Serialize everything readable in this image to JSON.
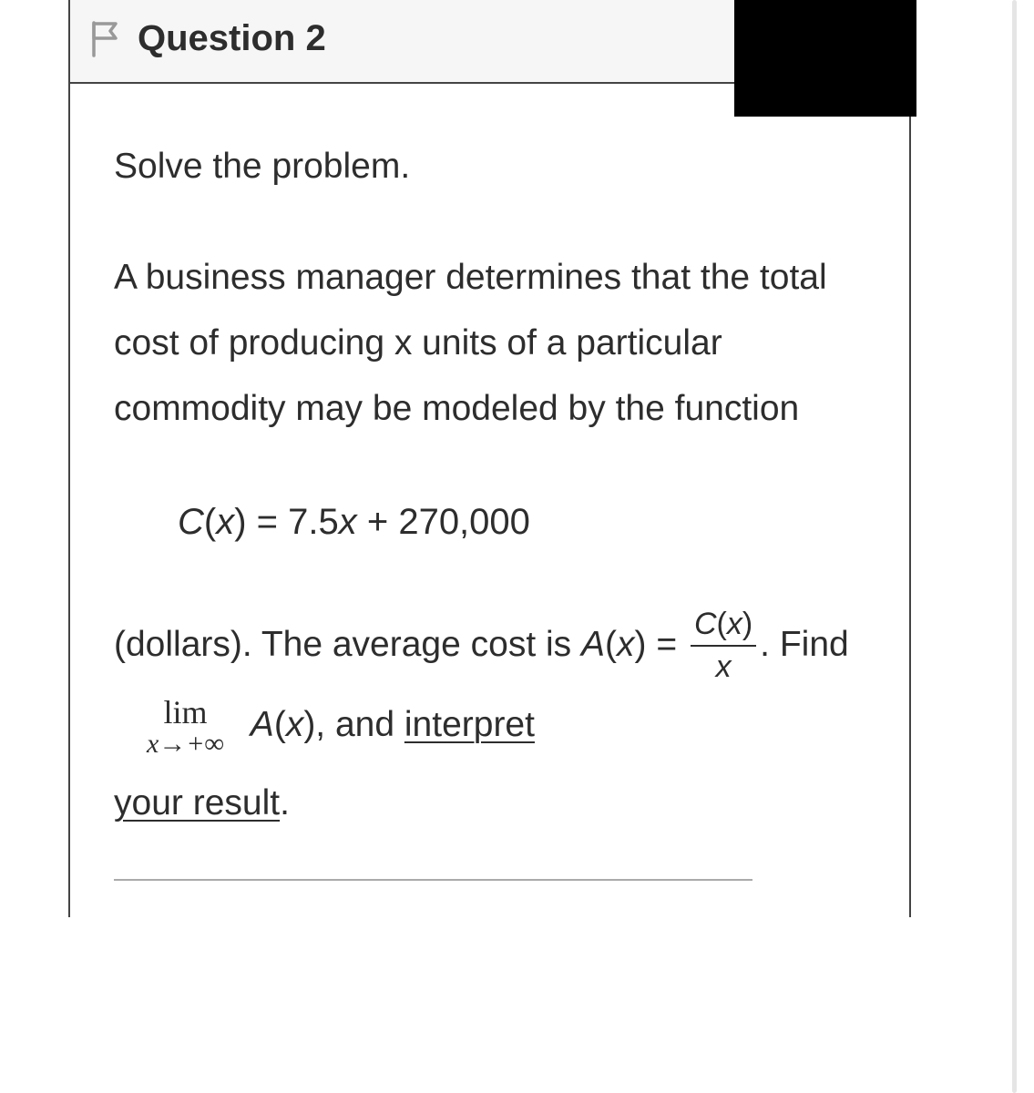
{
  "header": {
    "title": "Question 2"
  },
  "content": {
    "intro": "Solve the problem.",
    "body": "A business manager determines that the total cost of producing x units of a particular commodity may be modeled by the function",
    "equation": "C(x) = 7.5x + 270,000",
    "final_part1": "(dollars). The average cost is ",
    "final_Ax_eq": "A(x) = ",
    "fraction_top": "C(x)",
    "fraction_bottom": "x",
    "final_part2": ". Find ",
    "limit_top": "lim",
    "limit_bottom": "x→+∞",
    "final_part3": " A(x), and ",
    "interpret": "interpret",
    "your_result": "your result",
    "period": "."
  }
}
